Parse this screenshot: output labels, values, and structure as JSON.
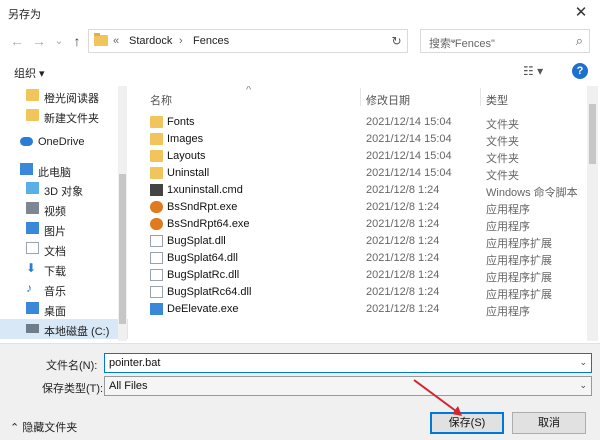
{
  "window": {
    "title": "另存为",
    "close_glyph": "✕"
  },
  "nav": {
    "back": "←",
    "forward": "→",
    "down": "⌄",
    "up": "↑",
    "breadcrumb": [
      "«",
      "Stardock",
      "›",
      "Fences"
    ],
    "address_dropdown": "⌄",
    "refresh": "↻",
    "search_placeholder": "搜索\"Fences\"",
    "search_icon": "⌕"
  },
  "toolbar": {
    "organize": "组织 ▾",
    "view": "☷ ▾",
    "help": "?"
  },
  "sidebar": {
    "items": [
      {
        "label": "橙光阅读器",
        "icon": "folder-icon"
      },
      {
        "label": "新建文件夹",
        "icon": "folder-icon"
      },
      {
        "label": "OneDrive",
        "icon": "cloud-icon"
      },
      {
        "label": "此电脑",
        "icon": "computer-icon"
      },
      {
        "label": "3D 对象",
        "icon": "cube-icon"
      },
      {
        "label": "视频",
        "icon": "video-icon"
      },
      {
        "label": "图片",
        "icon": "picture-icon"
      },
      {
        "label": "文档",
        "icon": "document-icon"
      },
      {
        "label": "下载",
        "icon": "download-icon"
      },
      {
        "label": "音乐",
        "icon": "music-icon"
      },
      {
        "label": "桌面",
        "icon": "desktop-icon"
      },
      {
        "label": "本地磁盘 (C:)",
        "icon": "drive-icon"
      }
    ]
  },
  "columns": {
    "name": "名称",
    "date": "修改日期",
    "type": "类型",
    "sort_arrow": "^"
  },
  "files": [
    {
      "name": "Fonts",
      "date": "2021/12/14 15:04",
      "type": "文件夹",
      "icon": "folder"
    },
    {
      "name": "Images",
      "date": "2021/12/14 15:04",
      "type": "文件夹",
      "icon": "folder"
    },
    {
      "name": "Layouts",
      "date": "2021/12/14 15:04",
      "type": "文件夹",
      "icon": "folder"
    },
    {
      "name": "Uninstall",
      "date": "2021/12/14 15:04",
      "type": "文件夹",
      "icon": "folder"
    },
    {
      "name": "1xuninstall.cmd",
      "date": "2021/12/8 1:24",
      "type": "Windows 命令脚本",
      "icon": "cmd"
    },
    {
      "name": "BsSndRpt.exe",
      "date": "2021/12/8 1:24",
      "type": "应用程序",
      "icon": "exe"
    },
    {
      "name": "BsSndRpt64.exe",
      "date": "2021/12/8 1:24",
      "type": "应用程序",
      "icon": "exe"
    },
    {
      "name": "BugSplat.dll",
      "date": "2021/12/8 1:24",
      "type": "应用程序扩展",
      "icon": "dll"
    },
    {
      "name": "BugSplat64.dll",
      "date": "2021/12/8 1:24",
      "type": "应用程序扩展",
      "icon": "dll"
    },
    {
      "name": "BugSplatRc.dll",
      "date": "2021/12/8 1:24",
      "type": "应用程序扩展",
      "icon": "dll"
    },
    {
      "name": "BugSplatRc64.dll",
      "date": "2021/12/8 1:24",
      "type": "应用程序扩展",
      "icon": "dll"
    },
    {
      "name": "DeElevate.exe",
      "date": "2021/12/8 1:24",
      "type": "应用程序",
      "icon": "exe2"
    }
  ],
  "form": {
    "filename_label": "文件名(N):",
    "filename_value": "pointer.bat",
    "filetype_label": "保存类型(T):",
    "filetype_value": "All Files",
    "dropdown_glyph": "⌄"
  },
  "footer": {
    "hide_folders": "⌃ 隐藏文件夹",
    "save": "保存(S)",
    "cancel": "取消"
  },
  "colors": {
    "accent": "#0078d7",
    "selection": "#d9e8f7",
    "annotation_arrow": "#d0282e"
  }
}
